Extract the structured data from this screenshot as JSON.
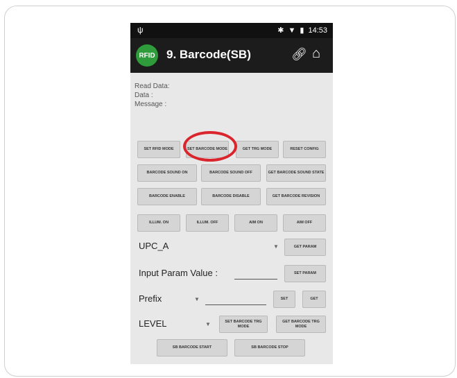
{
  "statusbar": {
    "time": "14:53"
  },
  "app": {
    "logo_text": "RFID",
    "title": "9. Barcode(SB)"
  },
  "info": {
    "read_data": "Read Data:",
    "data": "Data :",
    "message": "Message :"
  },
  "buttons": {
    "set_rfid_mode": "SET RFID MODE",
    "set_barcode_mode": "SET BARCODE MODE",
    "get_trg_mode": "GET TRG MODE",
    "reset_config": "RESET CONFIG",
    "barcode_sound_on": "BARCODE SOUND ON",
    "barcode_sound_off": "BARCODE SOUND OFF",
    "get_barcode_sound_state": "GET BARCODE SOUND STATE",
    "barcode_enable": "BARCODE ENABLE",
    "barcode_disable": "BARCODE DISABLE",
    "get_barcode_revision": "GET BARCODE REVISION",
    "illum_on": "ILLUM. ON",
    "illum_off": "ILLUM. OFF",
    "aim_on": "AIM ON",
    "aim_off": "AIM OFF",
    "get_param": "GET PARAM",
    "set_param": "SET PARAM",
    "set": "SET",
    "get": "GET",
    "set_barcode_trg_mode": "SET BARCODE TRG MODE",
    "get_barcode_trg_mode": "GET BARCODE TRG MODE",
    "sb_barcode_start": "SB BARCODE START",
    "sb_barcode_stop": "SB BARCODE STOP"
  },
  "fields": {
    "param_select": "UPC_A",
    "input_param_label": "Input Param Value :",
    "input_param_value": "",
    "prefix_select": "Prefix",
    "prefix_value": "",
    "level_select": "LEVEL"
  },
  "colors": {
    "highlight_circle": "#d9252b",
    "logo_green": "#2e9c3a",
    "appbar": "#1c1c1c"
  }
}
